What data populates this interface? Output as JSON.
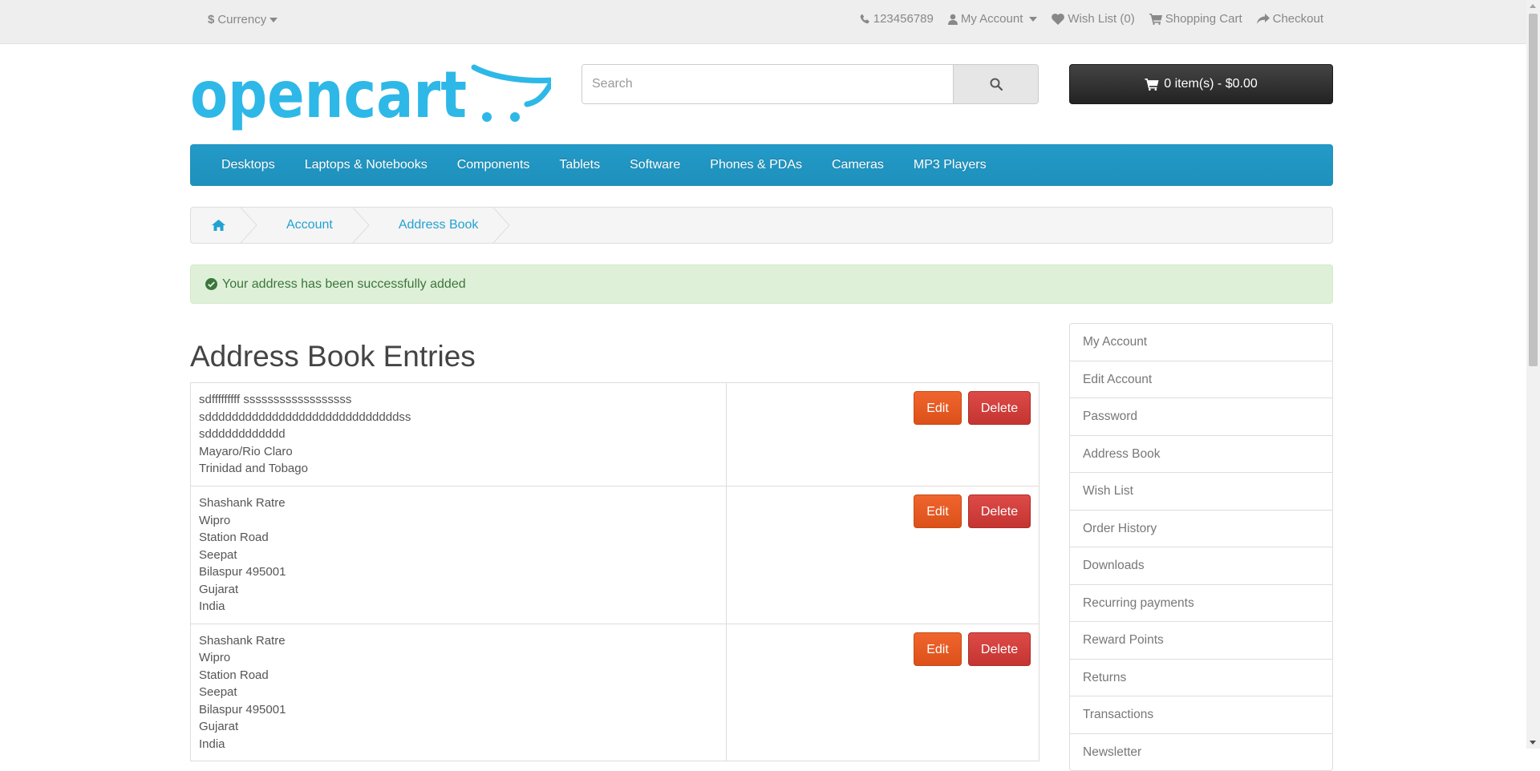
{
  "topbar": {
    "currency_symbol": "$",
    "currency_label": "Currency",
    "phone": "123456789",
    "my_account": "My Account",
    "wishlist": "Wish List (0)",
    "cart": "Shopping Cart",
    "checkout": "Checkout"
  },
  "header": {
    "logo_text": "opencart",
    "search_placeholder": "Search",
    "cart_button": "0 item(s) - $0.00"
  },
  "menu": [
    "Desktops",
    "Laptops & Notebooks",
    "Components",
    "Tablets",
    "Software",
    "Phones & PDAs",
    "Cameras",
    "MP3 Players"
  ],
  "breadcrumb": {
    "account": "Account",
    "address_book": "Address Book"
  },
  "alert": {
    "text": "Your address has been successfully added"
  },
  "content": {
    "title": "Address Book Entries",
    "edit_label": "Edit",
    "delete_label": "Delete",
    "addresses": [
      {
        "lines": [
          "sdfffffffff ssssssssssssssssss",
          "sdddddddddddddddddddddddddddddss",
          "sdddddddddddd",
          "Mayaro/Rio Claro",
          "Trinidad and Tobago"
        ]
      },
      {
        "lines": [
          "Shashank Ratre",
          "Wipro",
          "Station Road",
          "Seepat",
          "Bilaspur 495001",
          "Gujarat",
          "India"
        ]
      },
      {
        "lines": [
          "Shashank Ratre",
          "Wipro",
          "Station Road",
          "Seepat",
          "Bilaspur 495001",
          "Gujarat",
          "India"
        ]
      }
    ]
  },
  "sidebar": {
    "items": [
      "My Account",
      "Edit Account",
      "Password",
      "Address Book",
      "Wish List",
      "Order History",
      "Downloads",
      "Recurring payments",
      "Reward Points",
      "Returns",
      "Transactions",
      "Newsletter"
    ]
  },
  "colors": {
    "brand_blue": "#229ac8",
    "logo_blue": "#2eb8e7",
    "edit_orange": "#e5591f",
    "delete_red": "#d0403d",
    "alert_green": "#dff0d8"
  }
}
